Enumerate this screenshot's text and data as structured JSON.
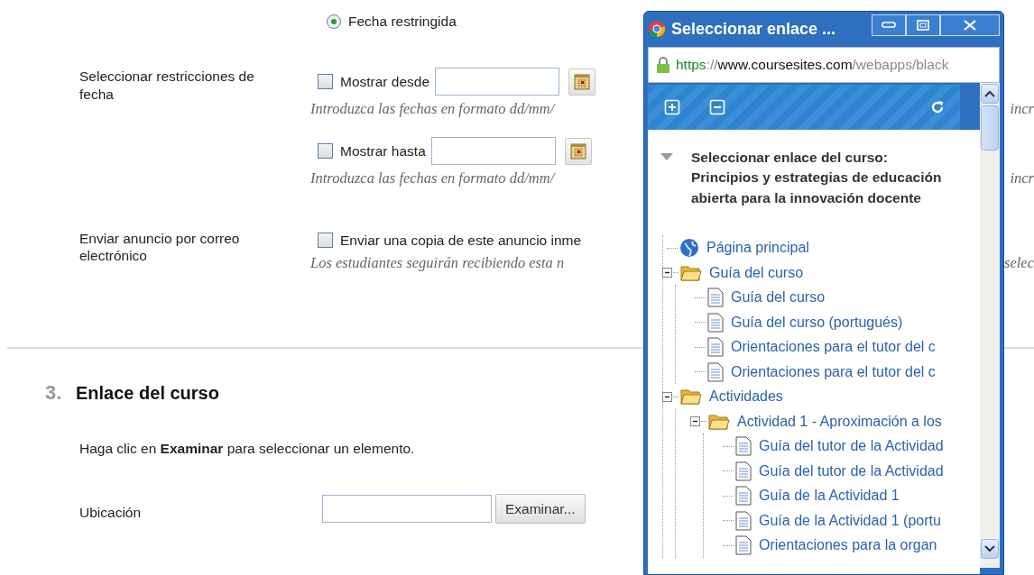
{
  "page": {
    "date_option": {
      "label": "Fecha restringida",
      "selected": true
    },
    "date_restrictions": {
      "label": "Seleccionar restricciones de fecha",
      "rows": [
        {
          "label": "Mostrar desde",
          "checked": false,
          "hint": "Introduzca las fechas en formato dd/mm/",
          "hint_tail": "incr"
        },
        {
          "label": "Mostrar hasta",
          "checked": false,
          "hint": "Introduzca las fechas en formato dd/mm/",
          "hint_tail": "incr"
        }
      ]
    },
    "email": {
      "label": "Enviar anuncio por correo electrónico",
      "option": {
        "label": "Enviar una copia de este anuncio inme",
        "checked": false
      },
      "hint": "Los estudiantes seguirán recibiendo esta n",
      "hint_tail": "selec"
    },
    "section": {
      "number": "3.",
      "title": "Enlace del curso",
      "instructions": "Haga clic en **Examinar** para seleccionar un elemento.",
      "location": {
        "label": "Ubicación",
        "button": "Examinar..."
      }
    }
  },
  "popup": {
    "title": "Seleccionar enlace ...",
    "url": {
      "scheme": "https",
      "separator": "://",
      "host": "www.coursesites.com",
      "path": "/webapps/black"
    },
    "heading": "Seleccionar enlace del curso: Principios y estrategias de educación abierta para la innovación docente",
    "tree": [
      {
        "kind": "globe",
        "label": "Página principal"
      },
      {
        "kind": "folder",
        "label": "Guía del curso",
        "expanded": true,
        "children": [
          {
            "kind": "page",
            "label": "Guía del curso"
          },
          {
            "kind": "page",
            "label": "Guía del curso (portugués)"
          },
          {
            "kind": "page",
            "label": "Orientaciones para el tutor del c"
          },
          {
            "kind": "page",
            "label": "Orientaciones para el tutor del c"
          }
        ]
      },
      {
        "kind": "folder",
        "label": "Actividades",
        "expanded": true,
        "children": [
          {
            "kind": "folder",
            "label": "Actividad 1 - Aproximación a los",
            "expanded": true,
            "children": [
              {
                "kind": "page",
                "label": "Guía del tutor de la Actividad"
              },
              {
                "kind": "page",
                "label": "Guía del tutor de la Actividad"
              },
              {
                "kind": "page",
                "label": "Guía de la Actividad 1"
              },
              {
                "kind": "page",
                "label": "Guía de la Actividad 1 (portu"
              },
              {
                "kind": "page",
                "label": "Orientaciones para la organ"
              }
            ]
          }
        ]
      }
    ]
  }
}
